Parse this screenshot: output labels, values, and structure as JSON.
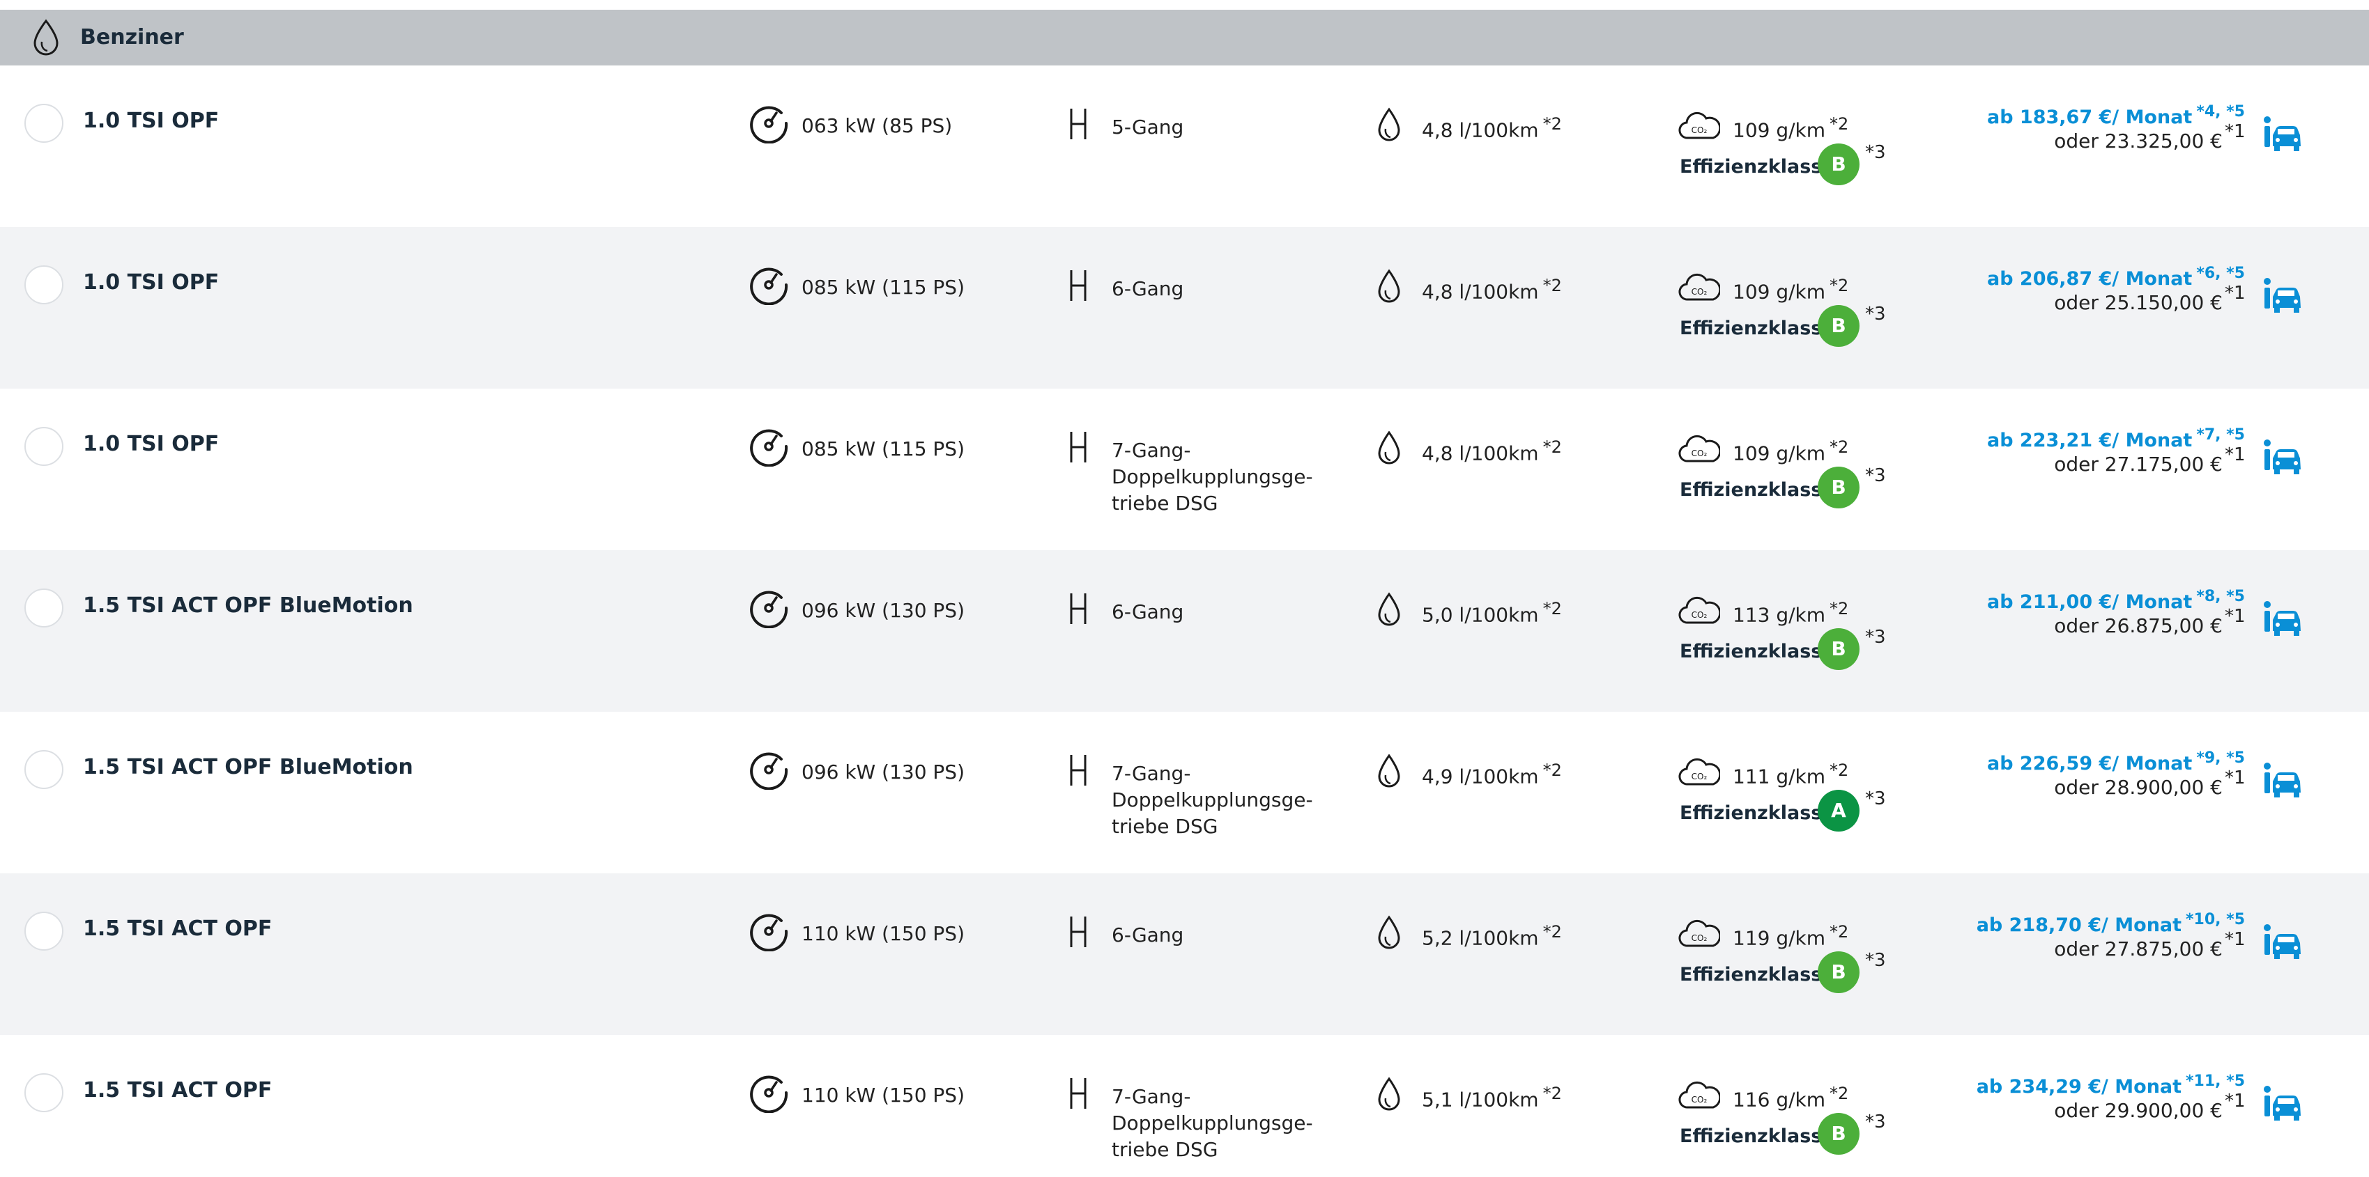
{
  "group": {
    "title": "Benziner",
    "icon": "fuel-drop-icon"
  },
  "labels": {
    "efficiency": "Effizienzklasse:"
  },
  "colors": {
    "header_bg": "#bfc3c7",
    "alt_row": "#f2f3f5",
    "price_blue": "#0a8fd6",
    "badge_b": "#4caf3a",
    "badge_a": "#0b9444"
  },
  "rows": [
    {
      "model": "1.0 TSI OPF",
      "power": "063 kW (85 PS)",
      "gearbox": "5-Gang",
      "consumption": "4,8 l/100km",
      "consumption_note": "*2",
      "co2": "109 g/km",
      "co2_note": "*2",
      "efficiency_class": "B",
      "efficiency_note": "*3",
      "monthly": "ab 183,67 €/ Monat",
      "monthly_note": "*4, *5",
      "total": "oder 23.325,00 €",
      "total_note": "*1"
    },
    {
      "model": "1.0 TSI OPF",
      "power": "085 kW (115 PS)",
      "gearbox": "6-Gang",
      "consumption": "4,8 l/100km",
      "consumption_note": "*2",
      "co2": "109 g/km",
      "co2_note": "*2",
      "efficiency_class": "B",
      "efficiency_note": "*3",
      "monthly": "ab 206,87 €/ Monat",
      "monthly_note": "*6, *5",
      "total": "oder 25.150,00 €",
      "total_note": "*1"
    },
    {
      "model": "1.0 TSI OPF",
      "power": "085 kW (115 PS)",
      "gearbox": "7-Gang-Doppelkupplungsge-triebe DSG",
      "consumption": "4,8 l/100km",
      "consumption_note": "*2",
      "co2": "109 g/km",
      "co2_note": "*2",
      "efficiency_class": "B",
      "efficiency_note": "*3",
      "monthly": "ab 223,21 €/ Monat",
      "monthly_note": "*7, *5",
      "total": "oder 27.175,00 €",
      "total_note": "*1"
    },
    {
      "model": "1.5 TSI ACT OPF BlueMotion",
      "power": "096 kW (130 PS)",
      "gearbox": "6-Gang",
      "consumption": "5,0 l/100km",
      "consumption_note": "*2",
      "co2": "113 g/km",
      "co2_note": "*2",
      "efficiency_class": "B",
      "efficiency_note": "*3",
      "monthly": "ab 211,00 €/ Monat",
      "monthly_note": "*8, *5",
      "total": "oder 26.875,00 €",
      "total_note": "*1"
    },
    {
      "model": "1.5 TSI ACT OPF BlueMotion",
      "power": "096 kW (130 PS)",
      "gearbox": "7-Gang-Doppelkupplungsge-triebe DSG",
      "consumption": "4,9 l/100km",
      "consumption_note": "*2",
      "co2": "111 g/km",
      "co2_note": "*2",
      "efficiency_class": "A",
      "efficiency_note": "*3",
      "monthly": "ab 226,59 €/ Monat",
      "monthly_note": "*9, *5",
      "total": "oder 28.900,00 €",
      "total_note": "*1"
    },
    {
      "model": "1.5 TSI ACT OPF",
      "power": "110 kW (150 PS)",
      "gearbox": "6-Gang",
      "consumption": "5,2 l/100km",
      "consumption_note": "*2",
      "co2": "119 g/km",
      "co2_note": "*2",
      "efficiency_class": "B",
      "efficiency_note": "*3",
      "monthly": "ab 218,70 €/ Monat",
      "monthly_note": "*10, *5",
      "total": "oder 27.875,00 €",
      "total_note": "*1"
    },
    {
      "model": "1.5 TSI ACT OPF",
      "power": "110 kW (150 PS)",
      "gearbox": "7-Gang-Doppelkupplungsge-triebe DSG",
      "consumption": "5,1 l/100km",
      "consumption_note": "*2",
      "co2": "116 g/km",
      "co2_note": "*2",
      "efficiency_class": "B",
      "efficiency_note": "*3",
      "monthly": "ab 234,29 €/ Monat",
      "monthly_note": "*11, *5",
      "total": "oder 29.900,00 €",
      "total_note": "*1"
    }
  ]
}
